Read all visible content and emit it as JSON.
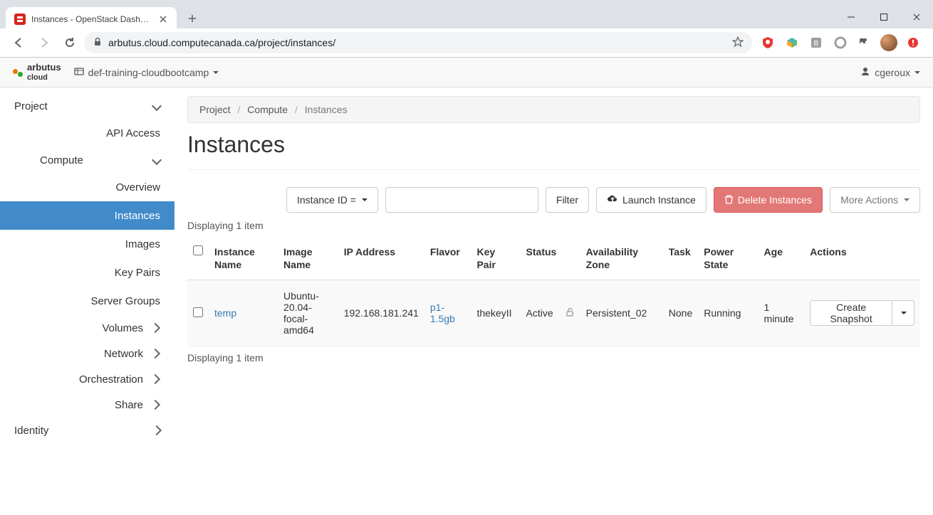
{
  "browser": {
    "tab_title": "Instances - OpenStack Dashboard",
    "url": "arbutus.cloud.computecanada.ca/project/instances/"
  },
  "topbar": {
    "brand_name": "arbutus",
    "brand_sub": "cloud",
    "project_name": "def-training-cloudbootcamp",
    "user": "cgeroux"
  },
  "sidebar": {
    "project": "Project",
    "api_access": "API Access",
    "compute": "Compute",
    "compute_children": {
      "overview": "Overview",
      "instances": "Instances",
      "images": "Images",
      "key_pairs": "Key Pairs",
      "server_groups": "Server Groups"
    },
    "volumes": "Volumes",
    "network": "Network",
    "orchestration": "Orchestration",
    "share": "Share",
    "identity": "Identity"
  },
  "breadcrumb": {
    "project": "Project",
    "compute": "Compute",
    "instances": "Instances"
  },
  "page_title": "Instances",
  "toolbar": {
    "filter_field": "Instance ID =",
    "filter_btn": "Filter",
    "launch_btn": "Launch Instance",
    "delete_btn": "Delete Instances",
    "more_btn": "More Actions"
  },
  "count_text": "Displaying 1 item",
  "table": {
    "headers": {
      "instance_name": "Instance Name",
      "image_name": "Image Name",
      "ip": "IP Address",
      "flavor": "Flavor",
      "key_pair": "Key Pair",
      "status": "Status",
      "az": "Availability Zone",
      "task": "Task",
      "power": "Power State",
      "age": "Age",
      "actions": "Actions"
    },
    "rows": [
      {
        "name": "temp",
        "image": "Ubuntu-20.04-focal-amd64",
        "ip": "192.168.181.241",
        "flavor": "p1-1.5gb",
        "key_pair": "thekeyII",
        "status": "Active",
        "az": "Persistent_02",
        "task": "None",
        "power": "Running",
        "age": "1 minute",
        "action": "Create Snapshot"
      }
    ]
  }
}
